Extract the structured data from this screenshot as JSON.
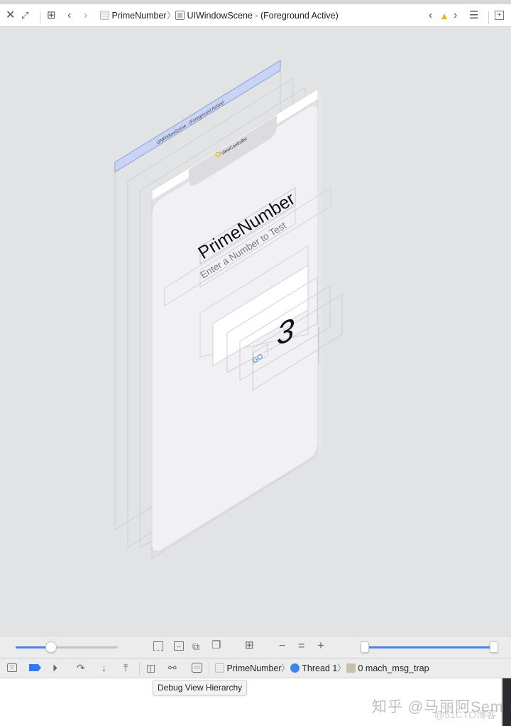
{
  "toolbar": {
    "close_icon": "close-icon",
    "expand_icon": "expand-icon",
    "grid_icon": "grid-icon",
    "back_icon": "chevron-left-icon",
    "forward_icon": "chevron-right-icon",
    "breadcrumb": [
      {
        "label": "PrimeNumber",
        "icon": "app-icon"
      },
      {
        "label": "UIWindowScene - (Foreground Active)",
        "icon": "window-icon"
      }
    ],
    "issue_prev_icon": "chevron-left-icon",
    "warning_icon": "warning-icon",
    "issue_next_icon": "chevron-right-icon",
    "lines_icon": "lines-icon",
    "add_editor_icon": "add-editor-icon"
  },
  "hierarchy": {
    "window_scene_label": "UIWindowScene - (Foreground Active)",
    "view_controller_label": "ViewController",
    "title_label": "PrimeNumber",
    "subtitle_label": "Enter a Number to Test",
    "field_value": "3",
    "button_label": "GO",
    "accent_color": "#2f7fdc",
    "scene_color": "#c9d3f4"
  },
  "view_controls": {
    "spacing_slider_value": 0.35,
    "range_slider_min": 0.0,
    "range_slider_max": 1.0,
    "zoom_minus": "−",
    "zoom_equal": "=",
    "zoom_plus": "+"
  },
  "debug_bar": {
    "breadcrumb": [
      {
        "label": "PrimeNumber",
        "icon": "app-icon"
      },
      {
        "label": "Thread 1",
        "icon": "thread-icon"
      },
      {
        "label": "0 mach_msg_trap",
        "icon": "frame-icon"
      }
    ],
    "tooltip": "Debug View Hierarchy"
  },
  "watermark": {
    "line1": "知乎 @马丽阿Sem",
    "line2": "@51CTO博客"
  }
}
